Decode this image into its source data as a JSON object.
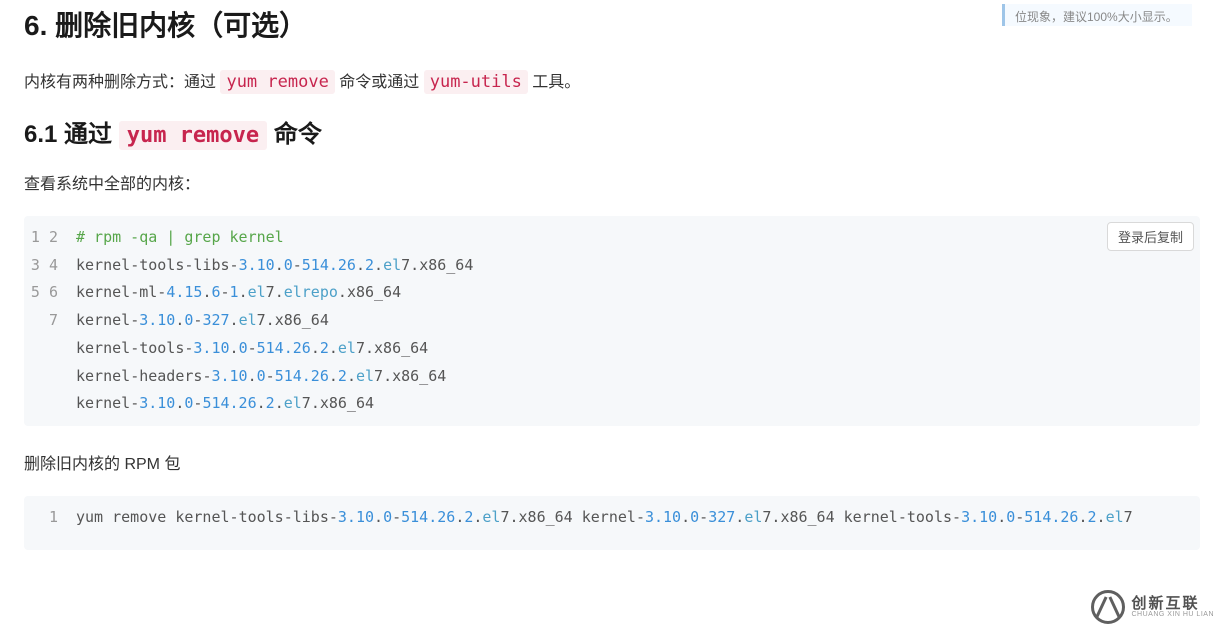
{
  "sideNote": "位现象，建议100%大小显示。",
  "section": {
    "title": "6. 删除旧内核（可选）",
    "intro_pre": "内核有两种删除方式：通过 ",
    "intro_code1": "yum remove",
    "intro_mid": " 命令或通过 ",
    "intro_code2": "yum-utils",
    "intro_post": " 工具。"
  },
  "subsection": {
    "title_pre": "6.1 通过 ",
    "title_code": "yum remove",
    "title_post": " 命令",
    "lead": "查看系统中全部的内核："
  },
  "copyLabel": "登录后复制",
  "code1": {
    "lines": [
      [
        {
          "c": "comment",
          "t": "# rpm -qa | grep kernel"
        }
      ],
      [
        {
          "c": "plain",
          "t": "kernel"
        },
        {
          "c": "punct",
          "t": "-"
        },
        {
          "c": "plain",
          "t": "tools"
        },
        {
          "c": "punct",
          "t": "-"
        },
        {
          "c": "plain",
          "t": "libs"
        },
        {
          "c": "punct",
          "t": "-"
        },
        {
          "c": "num",
          "t": "3.10"
        },
        {
          "c": "punct",
          "t": "."
        },
        {
          "c": "num",
          "t": "0"
        },
        {
          "c": "punct",
          "t": "-"
        },
        {
          "c": "num",
          "t": "514.26"
        },
        {
          "c": "punct",
          "t": "."
        },
        {
          "c": "num",
          "t": "2"
        },
        {
          "c": "punct",
          "t": "."
        },
        {
          "c": "kw",
          "t": "el"
        },
        {
          "c": "plain",
          "t": "7"
        },
        {
          "c": "punct",
          "t": "."
        },
        {
          "c": "plain",
          "t": "x86_64"
        }
      ],
      [
        {
          "c": "plain",
          "t": "kernel"
        },
        {
          "c": "punct",
          "t": "-"
        },
        {
          "c": "plain",
          "t": "ml"
        },
        {
          "c": "punct",
          "t": "-"
        },
        {
          "c": "num",
          "t": "4.15"
        },
        {
          "c": "punct",
          "t": "."
        },
        {
          "c": "num",
          "t": "6"
        },
        {
          "c": "punct",
          "t": "-"
        },
        {
          "c": "num",
          "t": "1"
        },
        {
          "c": "punct",
          "t": "."
        },
        {
          "c": "kw",
          "t": "el"
        },
        {
          "c": "plain",
          "t": "7"
        },
        {
          "c": "punct",
          "t": "."
        },
        {
          "c": "kw",
          "t": "elrepo"
        },
        {
          "c": "punct",
          "t": "."
        },
        {
          "c": "plain",
          "t": "x86_64"
        }
      ],
      [
        {
          "c": "plain",
          "t": "kernel"
        },
        {
          "c": "punct",
          "t": "-"
        },
        {
          "c": "num",
          "t": "3.10"
        },
        {
          "c": "punct",
          "t": "."
        },
        {
          "c": "num",
          "t": "0"
        },
        {
          "c": "punct",
          "t": "-"
        },
        {
          "c": "num",
          "t": "327"
        },
        {
          "c": "punct",
          "t": "."
        },
        {
          "c": "kw",
          "t": "el"
        },
        {
          "c": "plain",
          "t": "7"
        },
        {
          "c": "punct",
          "t": "."
        },
        {
          "c": "plain",
          "t": "x86_64"
        }
      ],
      [
        {
          "c": "plain",
          "t": "kernel"
        },
        {
          "c": "punct",
          "t": "-"
        },
        {
          "c": "plain",
          "t": "tools"
        },
        {
          "c": "punct",
          "t": "-"
        },
        {
          "c": "num",
          "t": "3.10"
        },
        {
          "c": "punct",
          "t": "."
        },
        {
          "c": "num",
          "t": "0"
        },
        {
          "c": "punct",
          "t": "-"
        },
        {
          "c": "num",
          "t": "514.26"
        },
        {
          "c": "punct",
          "t": "."
        },
        {
          "c": "num",
          "t": "2"
        },
        {
          "c": "punct",
          "t": "."
        },
        {
          "c": "kw",
          "t": "el"
        },
        {
          "c": "plain",
          "t": "7"
        },
        {
          "c": "punct",
          "t": "."
        },
        {
          "c": "plain",
          "t": "x86_64"
        }
      ],
      [
        {
          "c": "plain",
          "t": "kernel"
        },
        {
          "c": "punct",
          "t": "-"
        },
        {
          "c": "plain",
          "t": "headers"
        },
        {
          "c": "punct",
          "t": "-"
        },
        {
          "c": "num",
          "t": "3.10"
        },
        {
          "c": "punct",
          "t": "."
        },
        {
          "c": "num",
          "t": "0"
        },
        {
          "c": "punct",
          "t": "-"
        },
        {
          "c": "num",
          "t": "514.26"
        },
        {
          "c": "punct",
          "t": "."
        },
        {
          "c": "num",
          "t": "2"
        },
        {
          "c": "punct",
          "t": "."
        },
        {
          "c": "kw",
          "t": "el"
        },
        {
          "c": "plain",
          "t": "7"
        },
        {
          "c": "punct",
          "t": "."
        },
        {
          "c": "plain",
          "t": "x86_64"
        }
      ],
      [
        {
          "c": "plain",
          "t": "kernel"
        },
        {
          "c": "punct",
          "t": "-"
        },
        {
          "c": "num",
          "t": "3.10"
        },
        {
          "c": "punct",
          "t": "."
        },
        {
          "c": "num",
          "t": "0"
        },
        {
          "c": "punct",
          "t": "-"
        },
        {
          "c": "num",
          "t": "514.26"
        },
        {
          "c": "punct",
          "t": "."
        },
        {
          "c": "num",
          "t": "2"
        },
        {
          "c": "punct",
          "t": "."
        },
        {
          "c": "kw",
          "t": "el"
        },
        {
          "c": "plain",
          "t": "7"
        },
        {
          "c": "punct",
          "t": "."
        },
        {
          "c": "plain",
          "t": "x86_64"
        }
      ]
    ]
  },
  "para2": "删除旧内核的 RPM 包",
  "code2": {
    "lines": [
      [
        {
          "c": "plain",
          "t": "yum remove kernel"
        },
        {
          "c": "punct",
          "t": "-"
        },
        {
          "c": "plain",
          "t": "tools"
        },
        {
          "c": "punct",
          "t": "-"
        },
        {
          "c": "plain",
          "t": "libs"
        },
        {
          "c": "punct",
          "t": "-"
        },
        {
          "c": "num",
          "t": "3.10"
        },
        {
          "c": "punct",
          "t": "."
        },
        {
          "c": "num",
          "t": "0"
        },
        {
          "c": "punct",
          "t": "-"
        },
        {
          "c": "num",
          "t": "514.26"
        },
        {
          "c": "punct",
          "t": "."
        },
        {
          "c": "num",
          "t": "2"
        },
        {
          "c": "punct",
          "t": "."
        },
        {
          "c": "kw",
          "t": "el"
        },
        {
          "c": "plain",
          "t": "7"
        },
        {
          "c": "punct",
          "t": "."
        },
        {
          "c": "plain",
          "t": "x86_64 kernel"
        },
        {
          "c": "punct",
          "t": "-"
        },
        {
          "c": "num",
          "t": "3.10"
        },
        {
          "c": "punct",
          "t": "."
        },
        {
          "c": "num",
          "t": "0"
        },
        {
          "c": "punct",
          "t": "-"
        },
        {
          "c": "num",
          "t": "327"
        },
        {
          "c": "punct",
          "t": "."
        },
        {
          "c": "kw",
          "t": "el"
        },
        {
          "c": "plain",
          "t": "7"
        },
        {
          "c": "punct",
          "t": "."
        },
        {
          "c": "plain",
          "t": "x86_64 kernel"
        },
        {
          "c": "punct",
          "t": "-"
        },
        {
          "c": "plain",
          "t": "tools"
        },
        {
          "c": "punct",
          "t": "-"
        },
        {
          "c": "num",
          "t": "3.10"
        },
        {
          "c": "punct",
          "t": "."
        },
        {
          "c": "num",
          "t": "0"
        },
        {
          "c": "punct",
          "t": "-"
        },
        {
          "c": "num",
          "t": "514.26"
        },
        {
          "c": "punct",
          "t": "."
        },
        {
          "c": "num",
          "t": "2"
        },
        {
          "c": "punct",
          "t": "."
        },
        {
          "c": "kw",
          "t": "el"
        },
        {
          "c": "plain",
          "t": "7"
        }
      ]
    ]
  },
  "watermark": {
    "cn": "创新互联",
    "en": "CHUANG XIN HU LIAN"
  }
}
